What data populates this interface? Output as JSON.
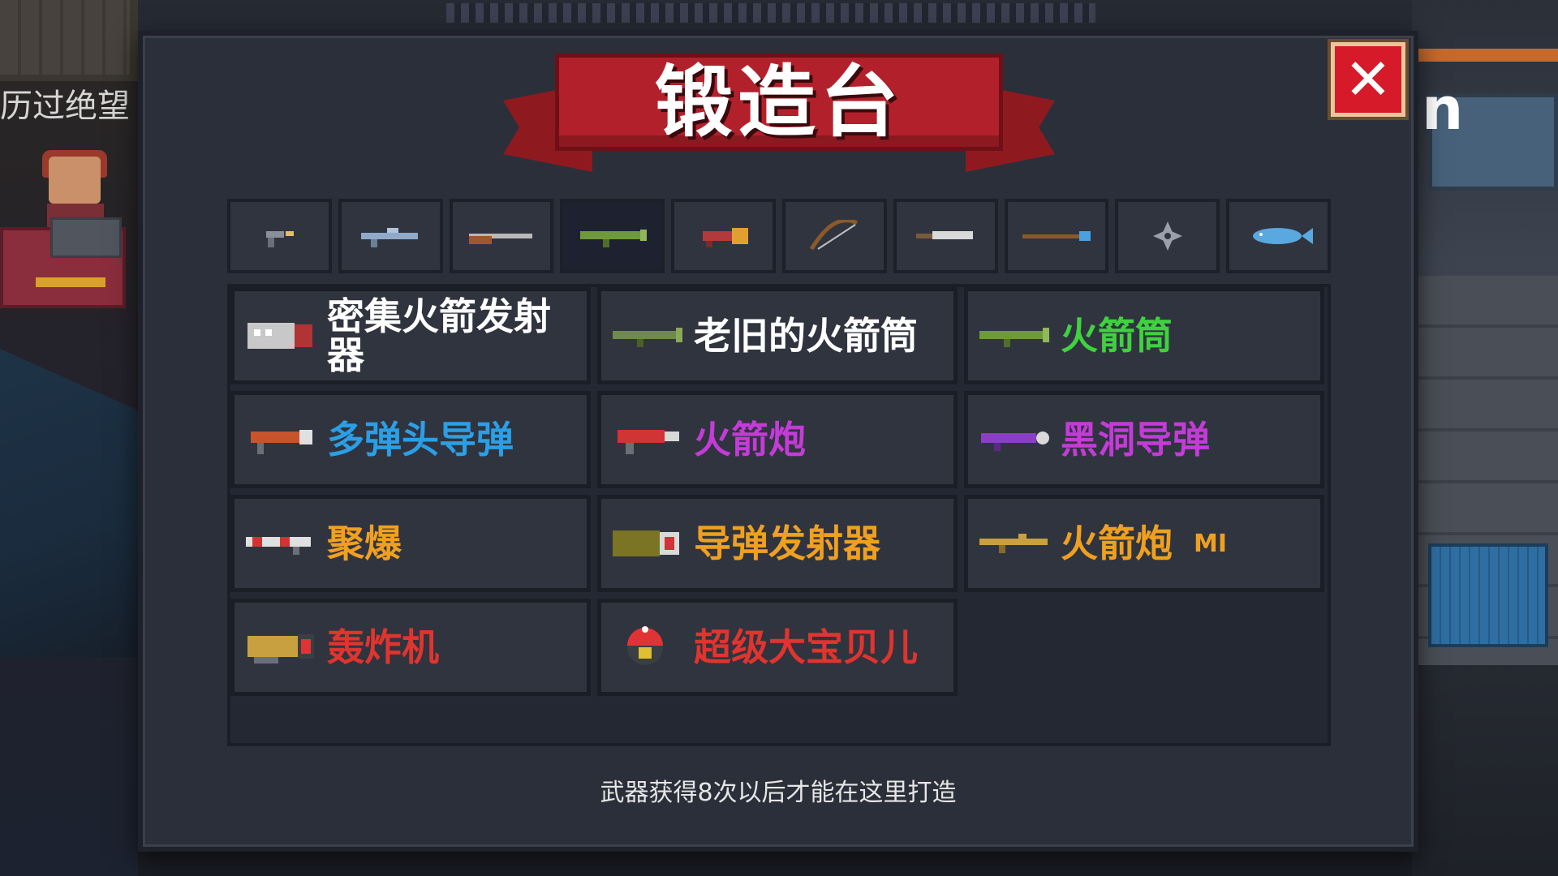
{
  "background": {
    "left_tip_text": "历过绝望",
    "right_glyph": "n"
  },
  "panel": {
    "title": "锻造台",
    "close_label": "✕",
    "hint": "武器获得8次以后才能在这里打造"
  },
  "tabs": [
    {
      "icon": "pistol-icon",
      "active": false
    },
    {
      "icon": "rifle-icon",
      "active": false
    },
    {
      "icon": "shotgun-icon",
      "active": false
    },
    {
      "icon": "rocket-launcher-icon",
      "active": true
    },
    {
      "icon": "laser-gun-icon",
      "active": false
    },
    {
      "icon": "bow-icon",
      "active": false
    },
    {
      "icon": "sword-icon",
      "active": false
    },
    {
      "icon": "staff-icon",
      "active": false
    },
    {
      "icon": "shuriken-icon",
      "active": false
    },
    {
      "icon": "fish-icon",
      "active": false
    }
  ],
  "weapons": [
    {
      "name": "密集火箭发射器",
      "color": "#ffffff",
      "icon": "dense-rocket-launcher-icon"
    },
    {
      "name": "老旧的火箭筒",
      "color": "#ffffff",
      "icon": "old-bazooka-icon"
    },
    {
      "name": "火箭筒",
      "color": "#3fd23f",
      "icon": "bazooka-icon"
    },
    {
      "name": "多弹头导弹",
      "color": "#2a9fe6",
      "icon": "multi-warhead-missile-icon"
    },
    {
      "name": "火箭炮",
      "color": "#c43bd8",
      "icon": "rocket-cannon-icon"
    },
    {
      "name": "黑洞导弹",
      "color": "#c43bd8",
      "icon": "black-hole-missile-icon"
    },
    {
      "name": "聚爆",
      "color": "#f0a020",
      "icon": "implosion-icon"
    },
    {
      "name": "导弹发射器",
      "color": "#f0a020",
      "icon": "missile-launcher-icon"
    },
    {
      "name": "火箭炮",
      "color": "#f0a020",
      "icon": "rocket-cannon-m1-icon",
      "badge": "MI"
    },
    {
      "name": "轰炸机",
      "color": "#e0342e",
      "icon": "bomber-icon"
    },
    {
      "name": "超级大宝贝儿",
      "color": "#e0342e",
      "icon": "super-big-baby-icon"
    }
  ]
}
